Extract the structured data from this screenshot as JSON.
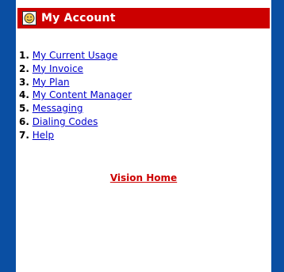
{
  "header": {
    "title": "My Account",
    "icon": "account-icon"
  },
  "menu": {
    "items": [
      {
        "number": "1.",
        "label": "My Current Usage"
      },
      {
        "number": "2.",
        "label": "My Invoice"
      },
      {
        "number": "3.",
        "label": "My Plan"
      },
      {
        "number": "4.",
        "label": "My Content Manager"
      },
      {
        "number": "5.",
        "label": "Messaging"
      },
      {
        "number": "6.",
        "label": "Dialing Codes"
      },
      {
        "number": "7.",
        "label": "Help"
      }
    ]
  },
  "footer": {
    "home_label": "Vision Home"
  },
  "colors": {
    "frame": "#0a4fa3",
    "header_bg": "#cc0000",
    "link": "#0000cc",
    "home_link": "#cc0000"
  }
}
